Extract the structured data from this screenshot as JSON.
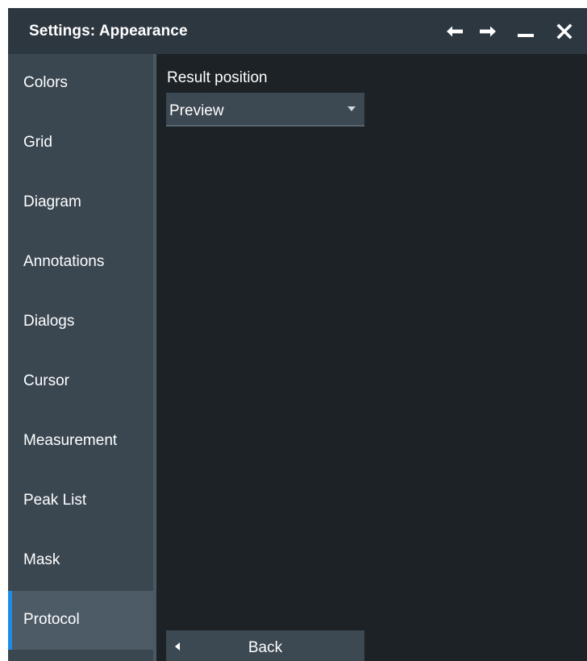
{
  "window": {
    "title": "Settings: Appearance",
    "buttons": [
      "back-arrow-icon",
      "forward-arrow-icon",
      "minimize-icon",
      "close-icon"
    ]
  },
  "sidebar": {
    "items": [
      {
        "label": "Colors",
        "active": false
      },
      {
        "label": "Grid",
        "active": false
      },
      {
        "label": "Diagram",
        "active": false
      },
      {
        "label": "Annotations",
        "active": false
      },
      {
        "label": "Dialogs",
        "active": false
      },
      {
        "label": "Cursor",
        "active": false
      },
      {
        "label": "Measurement",
        "active": false
      },
      {
        "label": "Peak List",
        "active": false
      },
      {
        "label": "Mask",
        "active": false
      },
      {
        "label": "Protocol",
        "active": true
      }
    ]
  },
  "main": {
    "result_position": {
      "label": "Result position",
      "value": "Preview"
    },
    "back_label": "Back"
  },
  "colors": {
    "accent": "#1e8ce6",
    "background": "#1c2226",
    "sidebar": "#3a4751",
    "titlebar": "#2d3740"
  }
}
